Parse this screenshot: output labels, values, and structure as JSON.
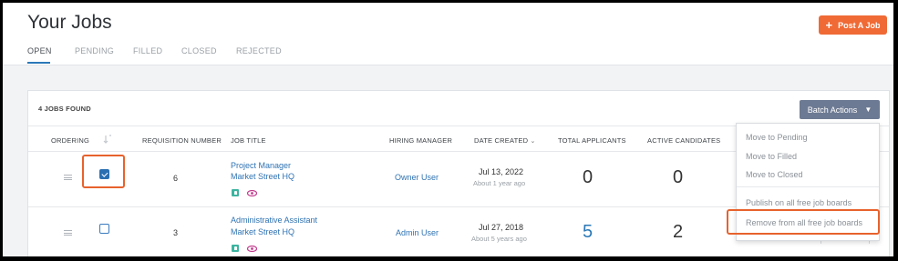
{
  "header": {
    "title": "Your Jobs",
    "post_button": "Post A Job",
    "tabs": [
      "OPEN",
      "PENDING",
      "FILLED",
      "CLOSED",
      "REJECTED"
    ]
  },
  "list": {
    "count_label": "4 JOBS FOUND",
    "batch_button": "Batch Actions",
    "columns": {
      "ordering": "ORDERING",
      "requisition": "REQUISITION NUMBER",
      "job_title": "JOB TITLE",
      "hiring_manager": "HIRING MANAGER",
      "date_created": "DATE CREATED",
      "total_applicants": "TOTAL APPLICANTS",
      "active_candidates": "ACTIVE CANDIDATES"
    },
    "rows": [
      {
        "checked": true,
        "requisition": "6",
        "title": "Project Manager",
        "location": "Market Street HQ",
        "manager": "Owner User",
        "date": "Jul 13, 2022",
        "date_ago": "About 1 year ago",
        "applicants": "0",
        "candidates": "0"
      },
      {
        "checked": false,
        "requisition": "3",
        "title": "Administrative Assistant",
        "location": "Market Street HQ",
        "manager": "Admin User",
        "date": "Jul 27, 2018",
        "date_ago": "About 5 years ago",
        "applicants": "5",
        "candidates": "2"
      }
    ]
  },
  "batch_menu": {
    "items": [
      "Move to Pending",
      "Move to Filled",
      "Move to Closed",
      "Publish on all free job boards",
      "Remove from all free job boards"
    ]
  },
  "colors": {
    "accent": "#f06a35",
    "link": "#2f73b3",
    "batch_button": "#6d7a93",
    "highlight": "#e8622c"
  }
}
